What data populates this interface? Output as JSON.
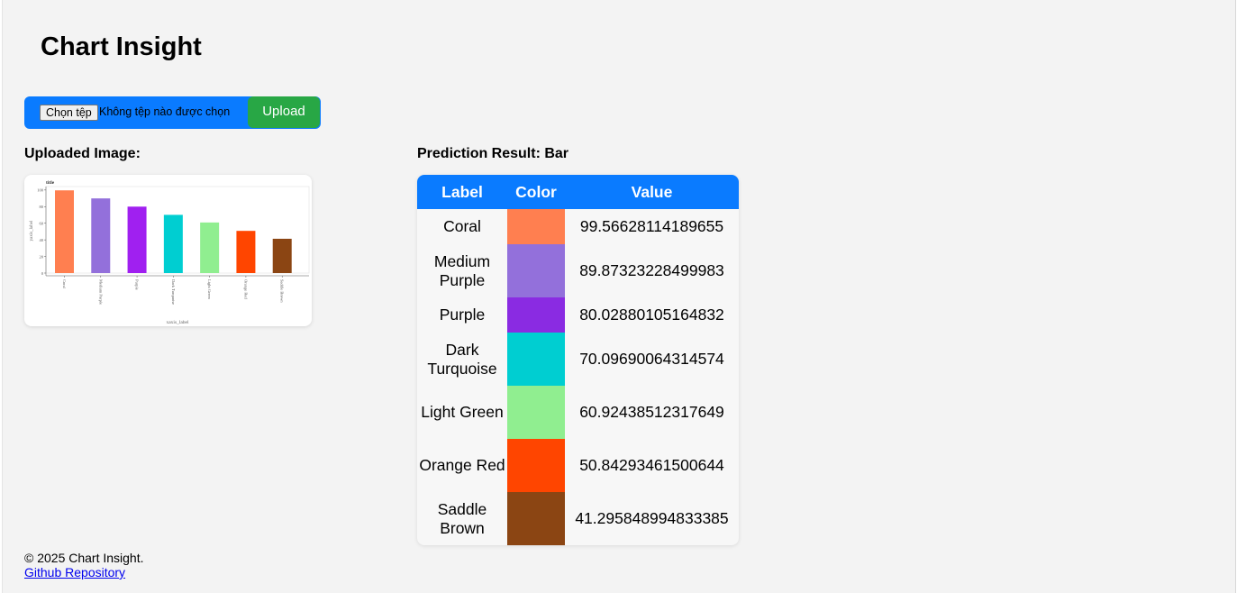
{
  "header": {
    "title": "Chart Insight"
  },
  "upload": {
    "choose_label": "Chọn tệp",
    "file_status": "Không tệp nào được chọn",
    "upload_label": "Upload"
  },
  "uploaded": {
    "heading": "Uploaded Image:"
  },
  "result": {
    "heading": "Prediction Result: Bar",
    "columns": [
      "Label",
      "Color",
      "Value"
    ],
    "rows": [
      {
        "label": "Coral",
        "color": "#ff7f50",
        "value": "99.56628114189655"
      },
      {
        "label": "Medium Purple",
        "color": "#9370db",
        "value": "89.87323228499983"
      },
      {
        "label": "Purple",
        "color": "#8a2be2",
        "value": "80.02880105164832"
      },
      {
        "label": "Dark Turquoise",
        "color": "#00ced1",
        "value": "70.09690064314574"
      },
      {
        "label": "Light Green",
        "color": "#90ee90",
        "value": "60.92438512317649"
      },
      {
        "label": "Orange Red",
        "color": "#ff4500",
        "value": "50.84293461500644"
      },
      {
        "label": "Saddle Brown",
        "color": "#8b4513",
        "value": "41.295848994833385"
      }
    ]
  },
  "chart_data": {
    "type": "bar",
    "title": "title",
    "xlabel": "xaxis_label",
    "ylabel": "yaxis_label",
    "categories": [
      "Coral",
      "Medium Purple",
      "Purple",
      "Dark Turquoise",
      "Light Green",
      "Orange Red",
      "Saddle Brown"
    ],
    "values": [
      99.6,
      89.9,
      80.0,
      70.1,
      60.9,
      50.8,
      41.3
    ],
    "colors": [
      "#ff7f50",
      "#9370db",
      "#a020f0",
      "#00ced1",
      "#90ee90",
      "#ff4500",
      "#8b4513"
    ],
    "ylim": [
      0,
      100
    ],
    "yticks": [
      "0",
      "20",
      "40",
      "60",
      "80",
      "100"
    ]
  },
  "footer": {
    "copyright": "© 2025 Chart Insight.",
    "link_label": "Github Repository"
  }
}
